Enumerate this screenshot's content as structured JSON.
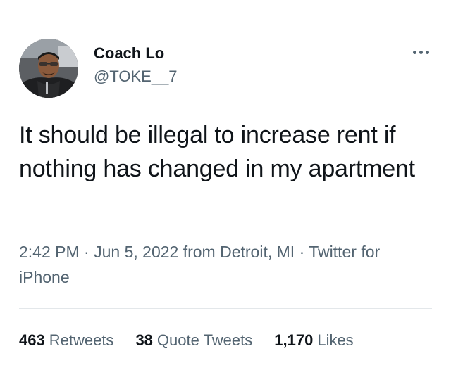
{
  "tweet": {
    "author": {
      "name": "Coach Lo",
      "handle": "@TOKE__7",
      "avatar": "user-avatar-photo"
    },
    "text": "It should be illegal to increase rent if nothing has changed in my apartment",
    "meta": {
      "time": "2:42 PM",
      "date": "Jun 5, 2022",
      "location": "from Detroit, MI",
      "source": "Twitter for iPhone",
      "separator": "·"
    },
    "stats": {
      "retweets": {
        "count": "463",
        "label": "Retweets"
      },
      "quote_tweets": {
        "count": "38",
        "label": "Quote Tweets"
      },
      "likes": {
        "count": "1,170",
        "label": "Likes"
      }
    }
  },
  "icons": {
    "more": "more-horizontal-icon"
  },
  "colors": {
    "text": "#0f1419",
    "secondary": "#536471",
    "divider": "#e3e7ea"
  }
}
